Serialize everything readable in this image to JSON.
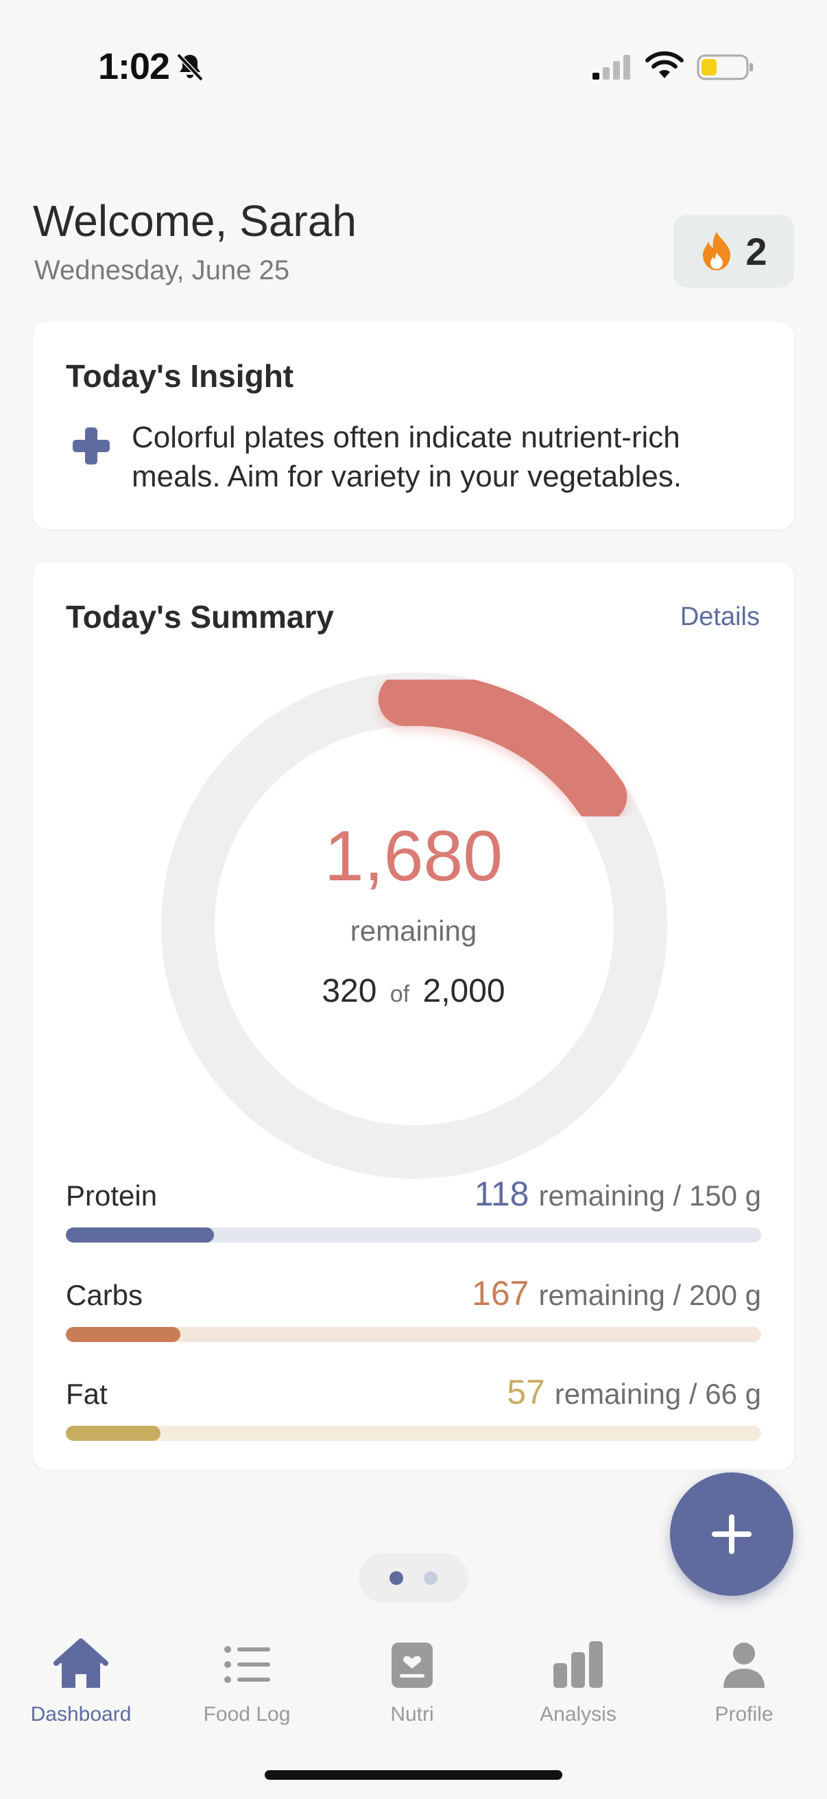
{
  "status_bar": {
    "time": "1:02",
    "icons": [
      "bell-slash-icon",
      "cellular-signal-icon",
      "wifi-icon",
      "battery-low-icon"
    ]
  },
  "header": {
    "welcome": "Welcome, Sarah",
    "date": "Wednesday, June 25",
    "streak_count": "2",
    "streak_icon": "flame-icon"
  },
  "insight": {
    "title": "Today's Insight",
    "icon": "plus-cross-icon",
    "text": "Colorful plates often indicate nutrient-rich meals. Aim for variety in your vegetables."
  },
  "summary": {
    "title": "Today's Summary",
    "details_label": "Details",
    "calories": {
      "remaining": "1,680",
      "remaining_label": "remaining",
      "consumed": "320",
      "of_word": "of",
      "goal": "2,000",
      "progress_fraction": 0.16
    },
    "macros": [
      {
        "name": "Protein",
        "remaining": "118",
        "detail": "remaining / 150 g",
        "fraction": 0.213,
        "color": "#5f6b9e",
        "track_color": "#e3e6ef"
      },
      {
        "name": "Carbs",
        "remaining": "167",
        "detail": "remaining / 200 g",
        "fraction": 0.165,
        "color": "#c97d56",
        "track_color": "#f5e6dc"
      },
      {
        "name": "Fat",
        "remaining": "57",
        "detail": "remaining / 66 g",
        "fraction": 0.136,
        "color": "#c8ac5f",
        "track_color": "#f4ecdc"
      }
    ]
  },
  "fab": {
    "icon": "plus-icon"
  },
  "pager": {
    "count": 2,
    "active": 0
  },
  "tabs": [
    {
      "label": "Dashboard",
      "icon": "home-icon",
      "active": true
    },
    {
      "label": "Food Log",
      "icon": "list-icon",
      "active": false
    },
    {
      "label": "Nutri",
      "icon": "nutri-card-icon",
      "active": false
    },
    {
      "label": "Analysis",
      "icon": "bar-chart-icon",
      "active": false
    },
    {
      "label": "Profile",
      "icon": "person-icon",
      "active": false
    }
  ],
  "colors": {
    "accent": "#5f6b9e",
    "calorie": "#d97b73",
    "ring_track": "#efefef",
    "inactive_tab": "#9a9a9a"
  }
}
